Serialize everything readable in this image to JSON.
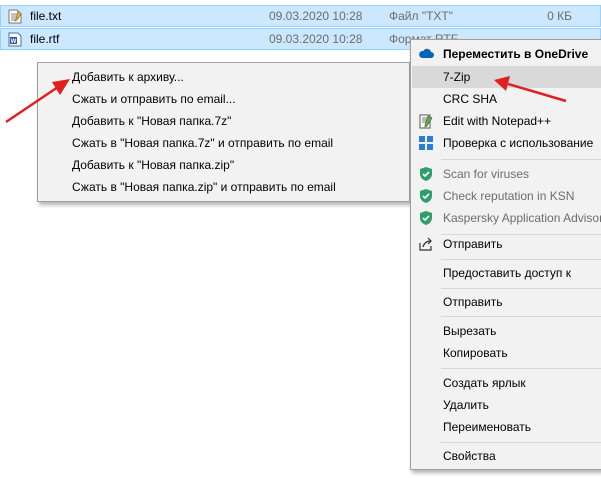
{
  "files": [
    {
      "name": "file.txt",
      "date": "09.03.2020 10:28",
      "type": "Файл \"TXT\"",
      "size": "0 КБ",
      "icon": "text-file-icon"
    },
    {
      "name": "file.rtf",
      "date": "09.03.2020 10:28",
      "type": "Формат RTF",
      "size": "",
      "icon": "wordpad-document-icon"
    }
  ],
  "submenu": {
    "items": [
      "Добавить к архиву...",
      "Сжать и отправить по email...",
      "Добавить к \"Новая папка.7z\"",
      "Сжать в \"Новая папка.7z\" и отправить по email",
      "Добавить к \"Новая папка.zip\"",
      "Сжать в \"Новая папка.zip\" и отправить по email"
    ]
  },
  "context_menu": {
    "onedrive": "Переместить в OneDrive",
    "seven_zip": "7-Zip",
    "crc_sha": "CRC SHA",
    "notepadpp": "Edit with Notepad++",
    "check_with": "Проверка с использование",
    "scan_viruses": "Scan for viruses",
    "check_reputation": "Check reputation in KSN",
    "kaspersky_advisor": "Kaspersky Application Advisor",
    "share": "Отправить",
    "give_access": "Предоставить доступ к",
    "send_to": "Отправить",
    "cut": "Вырезать",
    "copy": "Копировать",
    "create_shortcut": "Создать ярлык",
    "delete": "Удалить",
    "rename": "Переименовать",
    "properties": "Свойства"
  },
  "colors": {
    "selection": "#cce8ff",
    "menu_bg": "#f2f2f2",
    "hover": "#d9d9d9",
    "arrow": "#e02020",
    "kaspersky": "#2e9e6b",
    "onedrive": "#0364b8"
  }
}
